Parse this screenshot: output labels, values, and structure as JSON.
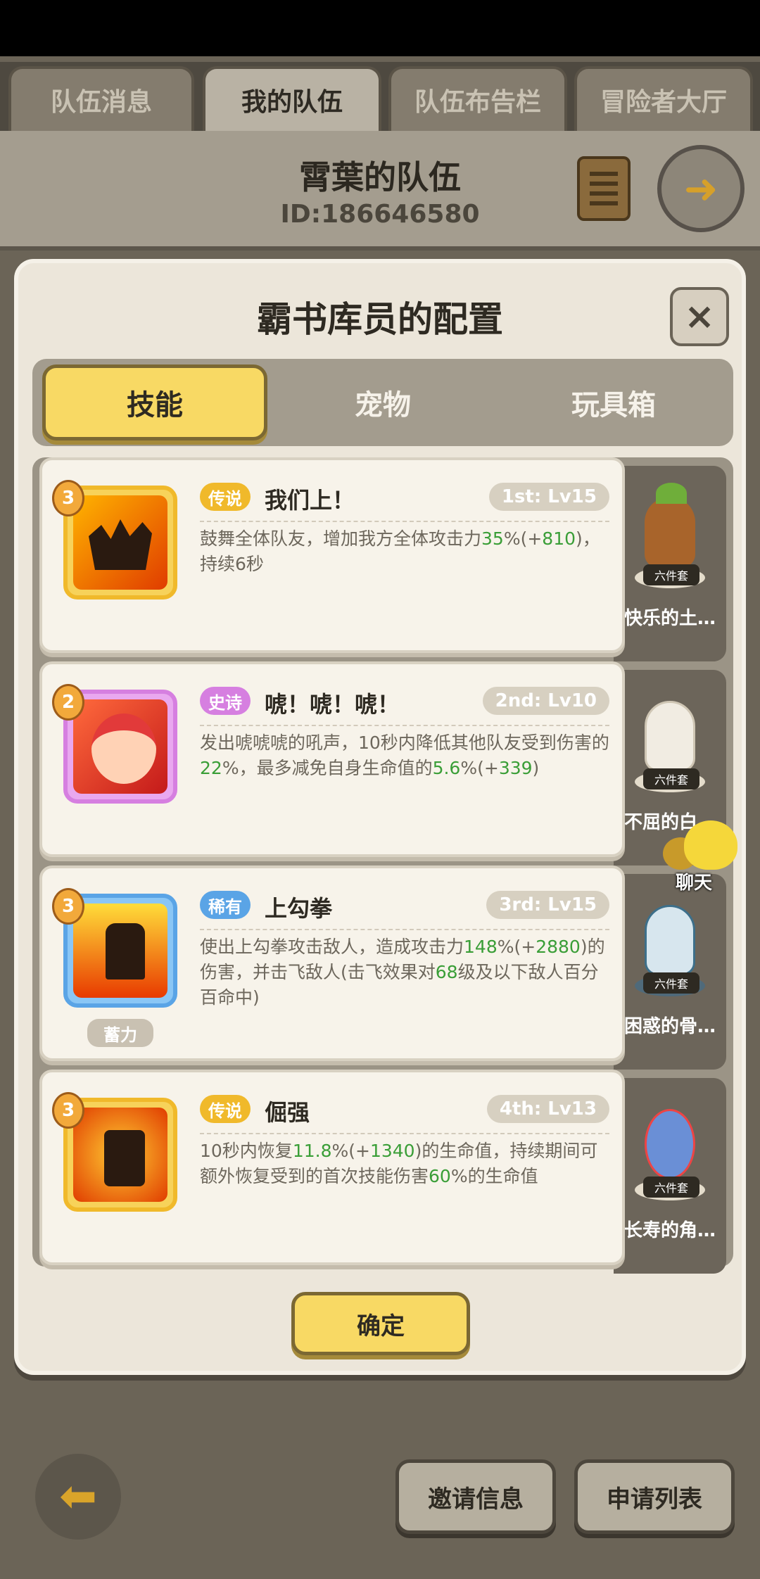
{
  "top_tabs": [
    "队伍消息",
    "我的队伍",
    "队伍布告栏",
    "冒险者大厅"
  ],
  "team": {
    "name": "霄葉的队伍",
    "id": "ID:186646580"
  },
  "modal": {
    "title": "霸书库员的配置",
    "close": "×",
    "sub_tabs": [
      "技能",
      "宠物",
      "玩具箱"
    ],
    "confirm": "确定"
  },
  "skills": [
    {
      "rank": "3",
      "rarity": "传说",
      "rarity_color": "#f0b92b",
      "name": "我们上！",
      "slot": "1st: Lv15",
      "desc": [
        {
          "t": "鼓舞全体队友，增加我方全体攻击力"
        },
        {
          "t": "35",
          "g": true
        },
        {
          "t": "%(+"
        },
        {
          "t": "810",
          "g": true
        },
        {
          "t": ")，持续6秒"
        }
      ],
      "pet_name": "快乐的土…",
      "pet_set": "六件套"
    },
    {
      "rank": "2",
      "rarity": "史诗",
      "rarity_color": "#d67fe0",
      "name": "唬！唬！唬！",
      "slot": "2nd: Lv10",
      "desc": [
        {
          "t": "发出唬唬唬的吼声，10秒内降低其他队友受到伤害的"
        },
        {
          "t": "22",
          "g": true
        },
        {
          "t": "%，最多减免自身生命值的"
        },
        {
          "t": "5.6",
          "g": true
        },
        {
          "t": "%(+"
        },
        {
          "t": "339",
          "g": true
        },
        {
          "t": ")"
        }
      ],
      "pet_name": "不屈的白…",
      "pet_set": "六件套"
    },
    {
      "rank": "3",
      "rarity": "稀有",
      "rarity_color": "#5aa4e6",
      "name": "上勾拳",
      "slot": "3rd: Lv15",
      "desc": [
        {
          "t": "使出上勾拳攻击敌人，造成攻击力"
        },
        {
          "t": "148",
          "g": true
        },
        {
          "t": "%(+"
        },
        {
          "t": "2880",
          "g": true
        },
        {
          "t": ")的伤害，并击飞敌人(击飞效果对"
        },
        {
          "t": "68",
          "g": true
        },
        {
          "t": "级及以下敌人百分百命中)"
        }
      ],
      "charge": "蓄力",
      "pet_name": "困惑的骨…",
      "pet_set": "六件套"
    },
    {
      "rank": "3",
      "rarity": "传说",
      "rarity_color": "#f0b92b",
      "name": "倔强",
      "slot": "4th: Lv13",
      "desc": [
        {
          "t": "10秒内恢复"
        },
        {
          "t": "11.8",
          "g": true
        },
        {
          "t": "%(+"
        },
        {
          "t": "1340",
          "g": true
        },
        {
          "t": ")的生命值，持续期间可额外恢复受到的首次技能伤害"
        },
        {
          "t": "60",
          "g": true
        },
        {
          "t": "%的生命值"
        }
      ],
      "pet_name": "长寿的角…",
      "pet_set": "六件套"
    }
  ],
  "chat": "聊天",
  "bottom": {
    "invite": "邀请信息",
    "apply": "申请列表"
  },
  "icons": {
    "back": "back-arrow-icon",
    "exit": "exit-team-icon",
    "scroll": "scroll-icon"
  }
}
